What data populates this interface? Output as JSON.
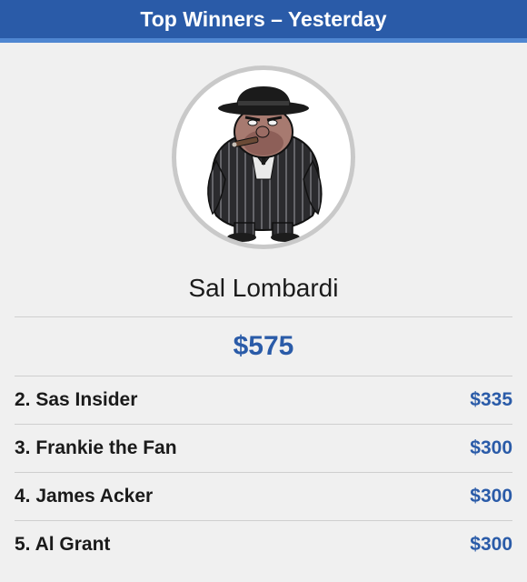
{
  "header": {
    "title": "Top Winners – Yesterday"
  },
  "colors": {
    "accent": "#2a5ba8",
    "header_bg": "#2a5ba8",
    "header_stripe": "#4f86d1"
  },
  "winner": {
    "avatar_icon": "gangster-avatar-icon",
    "name": "Sal Lombardi",
    "amount": "$575"
  },
  "runners_up": [
    {
      "rank_name": "2. Sas Insider",
      "amount": "$335"
    },
    {
      "rank_name": "3. Frankie the Fan",
      "amount": "$300"
    },
    {
      "rank_name": "4. James Acker",
      "amount": "$300"
    },
    {
      "rank_name": "5. Al Grant",
      "amount": "$300"
    }
  ]
}
